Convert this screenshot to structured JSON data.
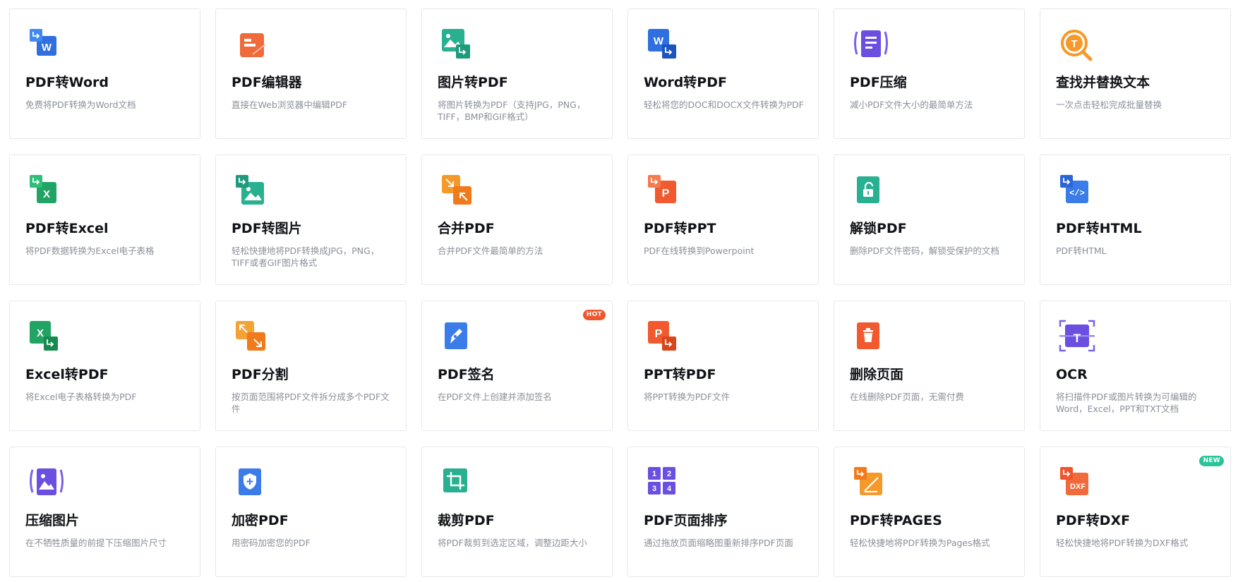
{
  "tools": [
    {
      "title": "PDF转Word",
      "desc": "免费将PDF转换为Word文档",
      "icon": "pdf-to-word-icon"
    },
    {
      "title": "PDF编辑器",
      "desc": "直接在Web浏览器中编辑PDF",
      "icon": "pdf-editor-icon"
    },
    {
      "title": "图片转PDF",
      "desc": "将图片转换为PDF（支持JPG，PNG，TIFF，BMP和GIF格式）",
      "icon": "image-to-pdf-icon"
    },
    {
      "title": "Word转PDF",
      "desc": "轻松将您的DOC和DOCX文件转换为PDF",
      "icon": "word-to-pdf-icon"
    },
    {
      "title": "PDF压缩",
      "desc": "减小PDF文件大小的最简单方法",
      "icon": "compress-pdf-icon"
    },
    {
      "title": "查找并替换文本",
      "desc": "一次点击轻松完成批量替换",
      "icon": "find-replace-icon"
    },
    {
      "title": "PDF转Excel",
      "desc": "将PDF数据转换为Excel电子表格",
      "icon": "pdf-to-excel-icon"
    },
    {
      "title": "PDF转图片",
      "desc": "轻松快捷地将PDF转换成JPG，PNG，TIFF或者GIF图片格式",
      "icon": "pdf-to-image-icon"
    },
    {
      "title": "合并PDF",
      "desc": "合并PDF文件最简单的方法",
      "icon": "merge-pdf-icon"
    },
    {
      "title": "PDF转PPT",
      "desc": "PDF在线转换到Powerpoint",
      "icon": "pdf-to-ppt-icon"
    },
    {
      "title": "解锁PDF",
      "desc": "删除PDF文件密码，解锁受保护的文档",
      "icon": "unlock-pdf-icon"
    },
    {
      "title": "PDF转HTML",
      "desc": "PDF转HTML",
      "icon": "pdf-to-html-icon"
    },
    {
      "title": "Excel转PDF",
      "desc": "将Excel电子表格转换为PDF",
      "icon": "excel-to-pdf-icon"
    },
    {
      "title": "PDF分割",
      "desc": "按页面范围将PDF文件拆分成多个PDF文件",
      "icon": "split-pdf-icon"
    },
    {
      "title": "PDF签名",
      "desc": "在PDF文件上创建并添加签名",
      "icon": "sign-pdf-icon",
      "badge": "HOT",
      "badgeColor": "#f0562e"
    },
    {
      "title": "PPT转PDF",
      "desc": "将PPT转换为PDF文件",
      "icon": "ppt-to-pdf-icon"
    },
    {
      "title": "删除页面",
      "desc": "在线删除PDF页面，无需付费",
      "icon": "delete-pages-icon"
    },
    {
      "title": "OCR",
      "desc": "将扫描件PDF或图片转换为可编辑的Word，Excel，PPT和TXT文档",
      "icon": "ocr-icon"
    },
    {
      "title": "压缩图片",
      "desc": "在不牺牲质量的前提下压缩图片尺寸",
      "icon": "compress-image-icon"
    },
    {
      "title": "加密PDF",
      "desc": "用密码加密您的PDF",
      "icon": "protect-pdf-icon"
    },
    {
      "title": "裁剪PDF",
      "desc": "将PDF裁剪到选定区域，调整边距大小",
      "icon": "crop-pdf-icon"
    },
    {
      "title": "PDF页面排序",
      "desc": "通过拖放页面缩略图重新排序PDF页面",
      "icon": "reorder-pages-icon"
    },
    {
      "title": "PDF转PAGES",
      "desc": "轻松快捷地将PDF转换为Pages格式",
      "icon": "pdf-to-pages-icon"
    },
    {
      "title": "PDF转DXF",
      "desc": "轻松快捷地将PDF转换为DXF格式",
      "icon": "pdf-to-dxf-icon",
      "badge": "NEW",
      "badgeColor": "#2bc49a"
    }
  ]
}
